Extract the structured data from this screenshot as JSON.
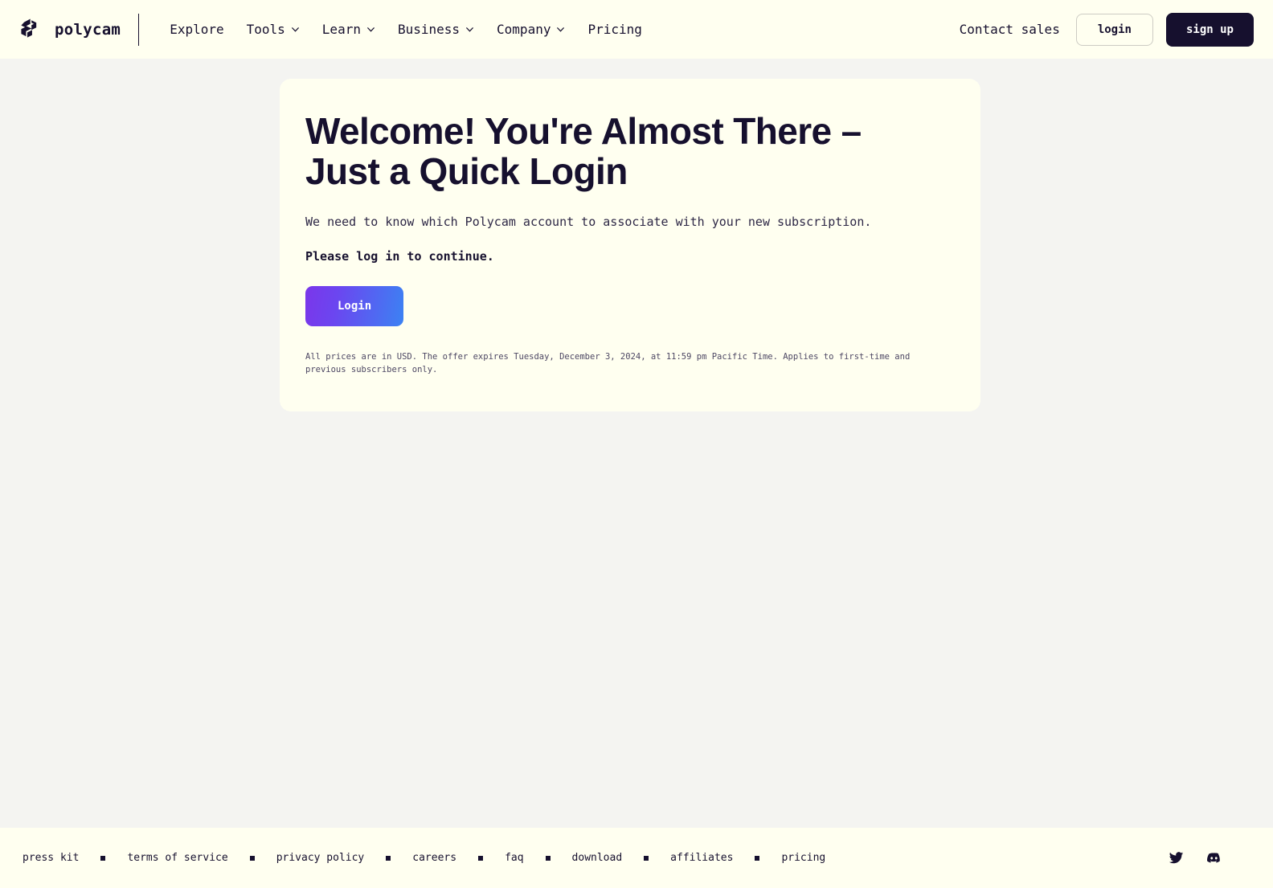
{
  "header": {
    "brand": {
      "name": "polycam",
      "logo_icon": "polycam-logo-icon"
    },
    "nav": [
      {
        "label": "Explore",
        "has_chevron": false
      },
      {
        "label": "Tools",
        "has_chevron": true
      },
      {
        "label": "Learn",
        "has_chevron": true
      },
      {
        "label": "Business",
        "has_chevron": true
      },
      {
        "label": "Company",
        "has_chevron": true
      },
      {
        "label": "Pricing",
        "has_chevron": false
      }
    ],
    "contact_sales": "Contact sales",
    "login_label": "login",
    "signup_label": "sign up"
  },
  "main": {
    "title": "Welcome! You're Almost There – Just a Quick Login",
    "subtitle": "We need to know which Polycam account to associate with your new subscription.",
    "prompt": "Please log in to continue.",
    "login_button": "Login",
    "fineprint": "All prices are in USD. The offer expires Tuesday, December 3, 2024, at 11:59 pm Pacific Time. Applies to first-time and previous subscribers only."
  },
  "footer": {
    "links": [
      "press kit",
      "terms of service",
      "privacy policy",
      "careers",
      "faq",
      "download",
      "affiliates",
      "pricing"
    ],
    "social": [
      {
        "name": "twitter-icon"
      },
      {
        "name": "discord-icon"
      }
    ]
  },
  "colors": {
    "page_background": "#f4f4f1",
    "surface": "#fffff0",
    "ink": "#16102e",
    "gradient_start": "#7b36ea",
    "gradient_end": "#3c82f3"
  }
}
